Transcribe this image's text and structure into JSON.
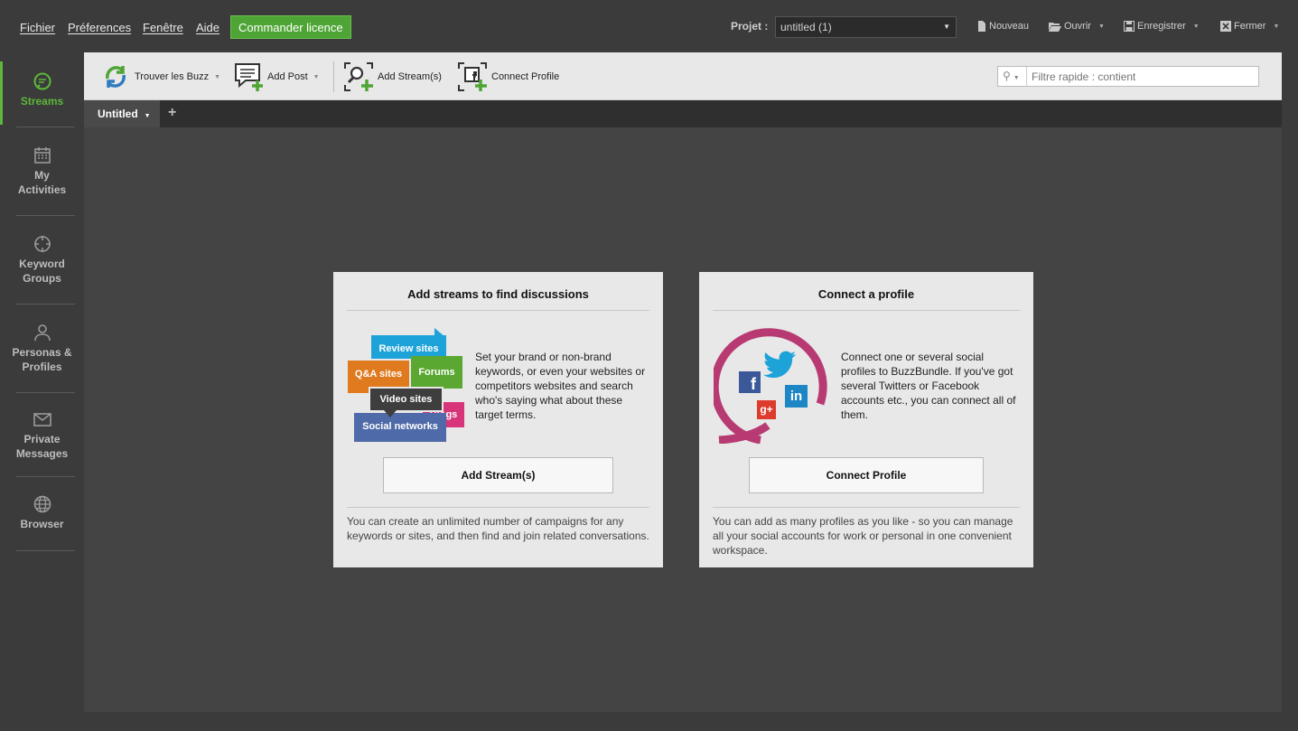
{
  "menubar": {
    "items": [
      "Fichier",
      "Préferences",
      "Fenêtre",
      "Aide"
    ],
    "license_button": "Commander licence",
    "project_label": "Projet :",
    "project_value": "untitled (1)",
    "actions": [
      {
        "label": "Nouveau",
        "icon": "new-file-icon"
      },
      {
        "label": "Ouvrir",
        "icon": "open-folder-icon"
      },
      {
        "label": "Enregistrer",
        "icon": "save-icon"
      },
      {
        "label": "Fermer",
        "icon": "close-icon"
      }
    ]
  },
  "sidebar": {
    "items": [
      {
        "label": "Streams",
        "icon": "streams-icon",
        "active": true
      },
      {
        "label": "My Activities",
        "icon": "calendar-icon"
      },
      {
        "label": "Keyword Groups",
        "icon": "target-icon"
      },
      {
        "label": "Personas & Profiles",
        "icon": "person-icon"
      },
      {
        "label": "Private Messages",
        "icon": "envelope-icon"
      },
      {
        "label": "Browser",
        "icon": "globe-icon"
      }
    ]
  },
  "toolbar": {
    "find_buzz": "Trouver les Buzz",
    "add_post": "Add Post",
    "add_stream": "Add Stream(s)",
    "connect_profile": "Connect Profile",
    "filter_placeholder": "Filtre rapide : contient"
  },
  "tabs": {
    "active": "Untitled",
    "add": "+"
  },
  "cards": {
    "streams": {
      "title": "Add streams to find discussions",
      "description": "Set your brand or non-brand keywords, or even your websites or competitors websites and search who's saying what about these target terms.",
      "button": "Add Stream(s)",
      "footer": "You can create an unlimited number of campaigns for any keywords or sites, and then find and join related conversations.",
      "bubbles": [
        "Review sites",
        "Q&A sites",
        "Forums",
        "Video sites",
        "Blogs",
        "Social networks"
      ]
    },
    "profile": {
      "title": "Connect a profile",
      "description": "Connect one or several social profiles to BuzzBundle. If you've got several Twitters or Facebook accounts etc., you can connect all of them.",
      "button": "Connect Profile",
      "footer": "You can add as many profiles as you like - so you can manage all your social accounts for work or personal in one convenient workspace.",
      "social_letters": {
        "facebook": "f",
        "googleplus": "g+",
        "linkedin": "in"
      }
    }
  },
  "colors": {
    "accent_green": "#5cb83a",
    "license_green": "#4ea535",
    "review_blue": "#1ea3d9",
    "qa_orange": "#e07a1f",
    "forums_green": "#5aa832",
    "video_dark": "#3e3e3e",
    "blogs_pink": "#d8347a",
    "social_blue": "#4f6aa8",
    "profile_ring": "#b83a73"
  }
}
